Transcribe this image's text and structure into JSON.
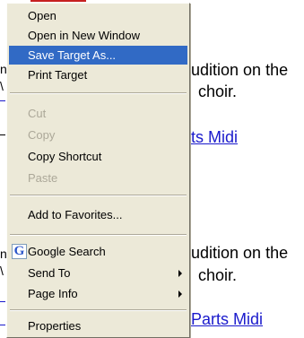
{
  "background": {
    "line1": "udition on the",
    "line2": "choir.",
    "link1": "ts Midi",
    "line3": "udition on the",
    "line4": "choir.",
    "link2": "Parts Midi",
    "frag_n1": "n",
    "frag_v1": "\\",
    "frag_n2": "n",
    "frag_v2": "\\"
  },
  "context_menu": {
    "items": [
      {
        "label": "Open",
        "state": "normal"
      },
      {
        "label": "Open in New Window",
        "state": "normal"
      },
      {
        "label": "Save Target As...",
        "state": "selected"
      },
      {
        "label": "Print Target",
        "state": "normal"
      },
      {
        "label": "Cut",
        "state": "disabled"
      },
      {
        "label": "Copy",
        "state": "disabled"
      },
      {
        "label": "Copy Shortcut",
        "state": "normal"
      },
      {
        "label": "Paste",
        "state": "disabled"
      },
      {
        "label": "Add to Favorites...",
        "state": "normal"
      },
      {
        "label": "Google Search",
        "state": "normal",
        "icon": "google-g-icon"
      },
      {
        "label": "Send To",
        "state": "normal",
        "submenu": true
      },
      {
        "label": "Page Info",
        "state": "normal",
        "submenu": true
      },
      {
        "label": "Properties",
        "state": "normal"
      }
    ]
  },
  "colors": {
    "menu_bg": "#ece9d8",
    "selection": "#316ac5",
    "disabled_text": "#aca899",
    "link": "#1a1acc"
  },
  "icons": {
    "google": "G"
  }
}
